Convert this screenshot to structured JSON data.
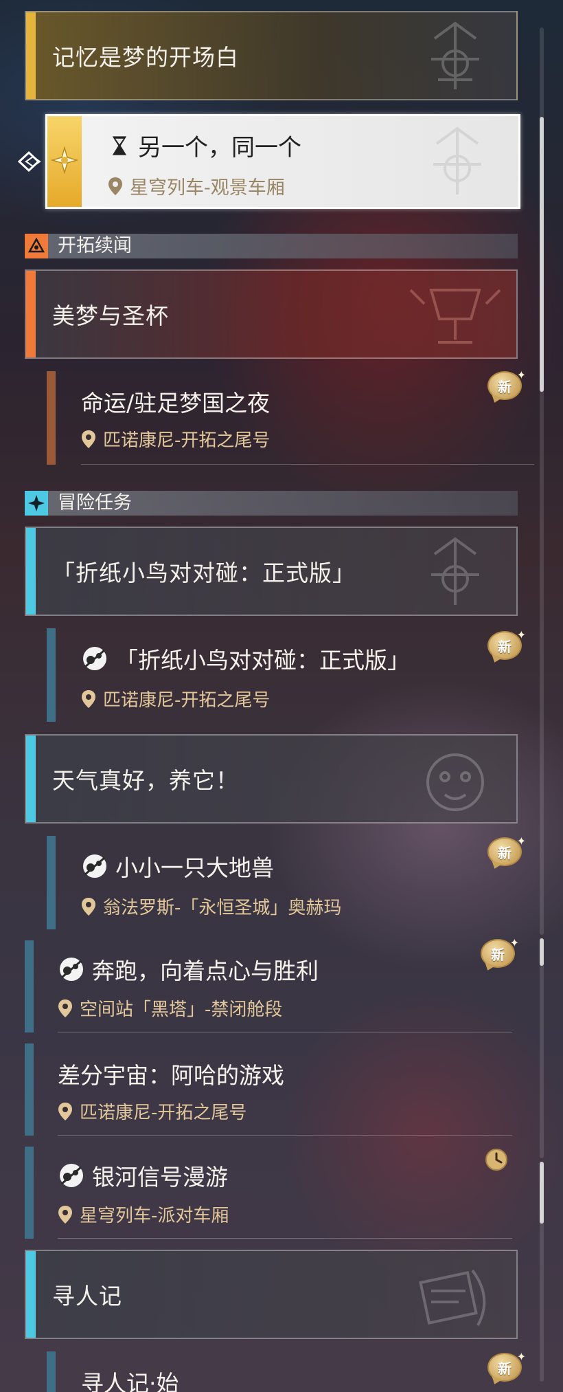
{
  "top_group": {
    "title": "记忆是梦的开场白",
    "active_quest": {
      "title": "另一个，同一个",
      "location": "星穹列车-观景车厢"
    }
  },
  "section_trailblaze": {
    "label": "开拓续闻",
    "groups": [
      {
        "title": "美梦与圣杯",
        "quests": [
          {
            "title": "命运/驻足梦国之夜",
            "location": "匹诺康尼-开拓之尾号",
            "badge": "新"
          }
        ]
      }
    ]
  },
  "section_adventure": {
    "label": "冒险任务",
    "groups": [
      {
        "title": "「折纸小鸟对对碰：正式版」",
        "quests": [
          {
            "title": "「折纸小鸟对对碰：正式版」",
            "location": "匹诺康尼-开拓之尾号",
            "badge": "新"
          }
        ]
      },
      {
        "title": "天气真好，养它！",
        "quests": [
          {
            "title": "小小一只大地兽",
            "location": "翁法罗斯-「永恒圣城」奥赫玛",
            "badge": "新"
          }
        ]
      }
    ],
    "loose_quests": [
      {
        "title": "奔跑，向着点心与胜利",
        "location": "空间站「黑塔」-禁闭舱段",
        "badge": "新"
      },
      {
        "title": "差分宇宙：阿哈的游戏",
        "location": "匹诺康尼-开拓之尾号"
      },
      {
        "title": "银河信号漫游",
        "location": "星穹列车-派对车厢"
      }
    ],
    "last_group": {
      "title": "寻人记",
      "quests": [
        {
          "title": "寻人记·始",
          "badge": "新"
        }
      ]
    }
  },
  "colors": {
    "gold": "#e4b43e",
    "orange": "#ef7a3a",
    "cyan": "#4ec9e4",
    "location": "#e2c79a",
    "brown_bar": "#9a5a3a",
    "teal_bar": "#3e6f86"
  },
  "icons": {
    "hourglass": "hourglass-icon",
    "pin": "location-pin-icon",
    "adventure": "adventure-quest-icon",
    "new": "new-badge-icon",
    "clock": "clock-icon"
  }
}
